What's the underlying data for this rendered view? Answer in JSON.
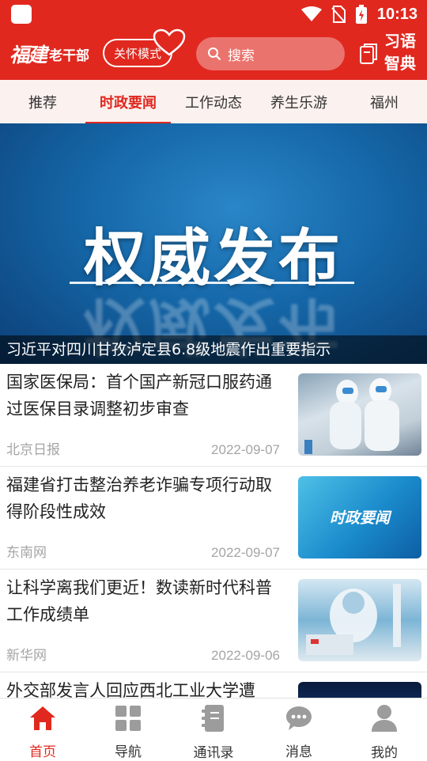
{
  "status_bar": {
    "time": "10:13"
  },
  "header": {
    "logo_script": "福建",
    "logo_text": "老干部",
    "care_mode_label": "关怀模式",
    "search_placeholder": "搜索",
    "dict_label": "习语智典"
  },
  "tabs": [
    {
      "label": "推荐"
    },
    {
      "label": "时政要闻",
      "active": true
    },
    {
      "label": "工作动态"
    },
    {
      "label": "养生乐游"
    },
    {
      "label": "福州"
    }
  ],
  "banner": {
    "title": "权威发布",
    "caption": "习近平对四川甘孜泸定县6.8级地震作出重要指示"
  },
  "news": [
    {
      "title": "国家医保局：首个国产新冠口服药通过医保目录调整初步审查",
      "source": "北京日报",
      "date": "2022-09-07"
    },
    {
      "title": "福建省打击整治养老诈骗专项行动取得阶段性成效",
      "source": "东南网",
      "date": "2022-09-07",
      "thumb_text": "时政要闻"
    },
    {
      "title": "让科学离我们更近！数读新时代科普工作成绩单",
      "source": "新华网",
      "date": "2022-09-06"
    },
    {
      "title": "外交部发言人回应西北工业大学遭"
    }
  ],
  "bottom_nav": [
    {
      "label": "首页",
      "icon": "home-icon",
      "active": true
    },
    {
      "label": "导航",
      "icon": "grid-icon"
    },
    {
      "label": "通讯录",
      "icon": "contacts-book-icon"
    },
    {
      "label": "消息",
      "icon": "chat-bubble-icon"
    },
    {
      "label": "我的",
      "icon": "user-icon"
    }
  ],
  "colors": {
    "brand_red": "#e0281f",
    "tab_bg": "#fbf1ee",
    "muted_text": "#a5a5a5"
  }
}
